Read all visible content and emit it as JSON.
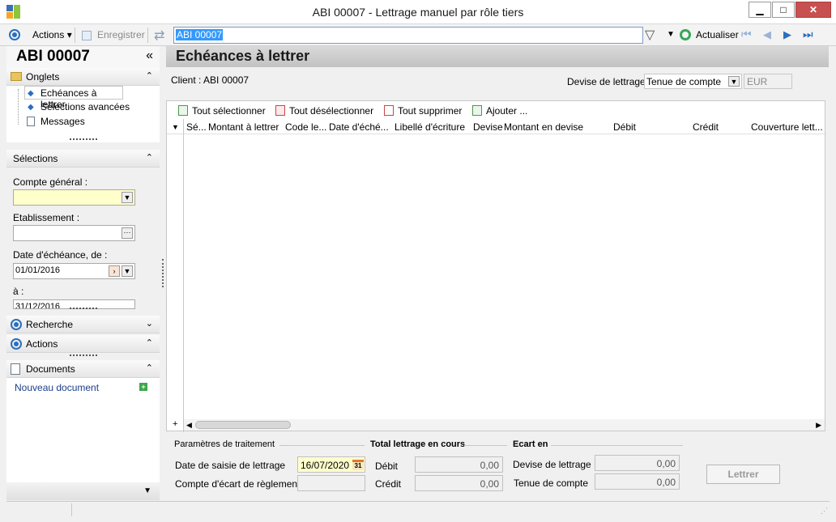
{
  "window": {
    "title": "ABI 00007 -  Lettrage manuel par rôle tiers",
    "minimize": "▁",
    "maximize": "□",
    "close": "✕"
  },
  "toolbar": {
    "actions_label": "Actions",
    "save_label": "Enregistrer",
    "search_value": "ABI 00007",
    "refresh_label": "Actualiser",
    "nav_first": "⏮",
    "nav_prev": "◀",
    "nav_next": "▶",
    "nav_last": "⏭"
  },
  "left": {
    "header_title": "ABI 00007",
    "collapse": "«",
    "onglets": {
      "title": "Onglets",
      "items": [
        "Echéances à lettrer",
        "Sélections avancées",
        "Messages"
      ]
    },
    "selections": {
      "title": "Sélections",
      "compte_label": "Compte général :",
      "etab_label": "Etablissement :",
      "date_de_label": "Date d'échéance, de :",
      "date_de_value": "01/01/2016",
      "date_a_label": "à :",
      "date_a_value": "31/12/2016"
    },
    "recherche_title": "Recherche",
    "actions_title": "Actions",
    "documents": {
      "title": "Documents",
      "new_doc": "Nouveau document"
    }
  },
  "main": {
    "title": "Echéances à lettrer",
    "client_label": "Client : ABI 00007",
    "devise_label": "Devise de lettrage :",
    "devise_value": "Tenue de compte",
    "devise_code": "EUR",
    "grid_actions": [
      "Tout sélectionner",
      "Tout désélectionner",
      "Tout supprimer",
      "Ajouter ..."
    ],
    "columns": [
      "Sé...",
      "Montant à lettrer",
      "Code le...",
      "Date d'éché...",
      "Libellé d'écriture",
      "Devise",
      "Montant en devise",
      "Débit",
      "Crédit",
      "Couverture lett..."
    ],
    "params": {
      "title": "Paramètres de traitement",
      "date_label": "Date de saisie de lettrage",
      "date_value": "16/07/2020",
      "ecart_label": "Compte d'écart de règlement"
    },
    "total": {
      "title": "Total lettrage en cours",
      "debit_label": "Débit",
      "debit_value": "0,00",
      "credit_label": "Crédit",
      "credit_value": "0,00"
    },
    "ecart": {
      "title": "Ecart en",
      "devise_label": "Devise de lettrage",
      "devise_value": "0,00",
      "tenue_label": "Tenue de compte",
      "tenue_value": "0,00"
    },
    "lettrer_label": "Lettrer"
  }
}
